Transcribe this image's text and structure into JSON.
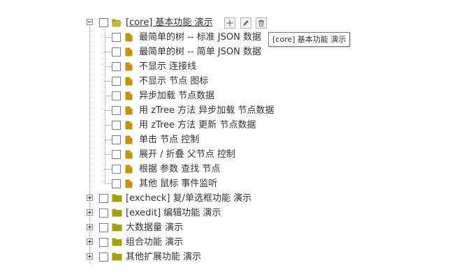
{
  "tree": {
    "root_open": {
      "label": "[core] 基本功能 演示",
      "children": [
        "最简单的树 -- 标准 JSON 数据",
        "最简单的树 -- 简单 JSON 数据",
        "不显示 连接线",
        "不显示 节点 图标",
        "异步加载 节点数据",
        "用 zTree 方法 异步加载 节点数据",
        "用 zTree 方法 更新 节点数据",
        "单击 节点 控制",
        "展开 / 折叠 父节点 控制",
        "根据 参数 查找 节点",
        "其他 鼠标 事件监听"
      ]
    },
    "root_closed": [
      "[excheck] 复/单选框功能 演示",
      "[exedit] 编辑功能 演示",
      "大数据量 演示",
      "组合功能 演示",
      "其他扩展功能 演示"
    ]
  },
  "tooltip": "[core] 基本功能 演示",
  "icons": {
    "folder_open": "folder-open-icon",
    "folder": "folder-icon",
    "file": "file-icon",
    "add": "add-icon",
    "edit": "edit-pencil-icon",
    "remove": "trash-icon"
  },
  "colors": {
    "folder": "#a1a100",
    "file": "#c59200",
    "tree_line": "#9a9a9a"
  }
}
